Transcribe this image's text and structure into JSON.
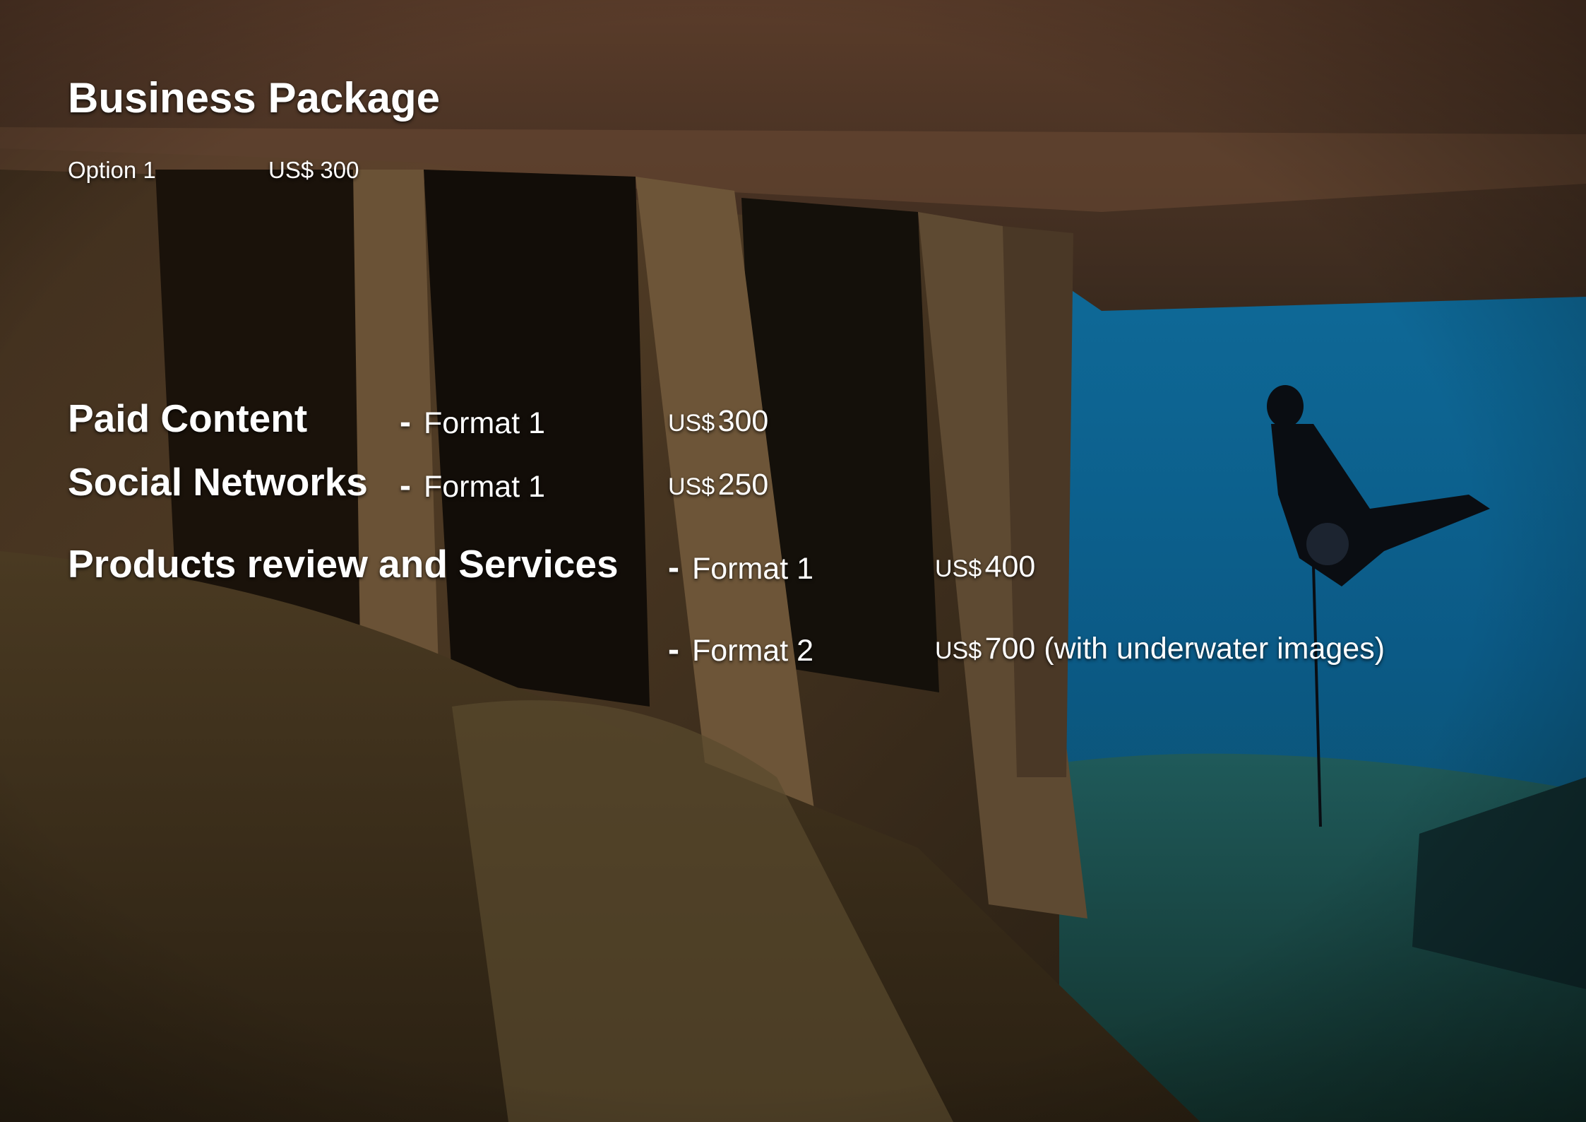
{
  "slide": {
    "title": "Business Package",
    "option": {
      "label": "Option 1",
      "price": "US$ 300"
    },
    "items": [
      {
        "heading": "Paid Content",
        "format": "Format 1",
        "currency": "US$",
        "amount": "300"
      },
      {
        "heading": "Social Networks",
        "format": "Format 1",
        "currency": "US$",
        "amount": "250"
      },
      {
        "heading": "Products review and Services",
        "format": "Format 1",
        "currency": "US$",
        "amount": "400"
      },
      {
        "heading": "",
        "format": "Format 2",
        "currency": "US$",
        "amount": "700 (with underwater images)"
      }
    ],
    "dash": "-"
  },
  "background": {
    "description_icon": "underwater-shipwreck-photo",
    "colors": {
      "wreck": "#5a4530",
      "rust": "#7a4a2a",
      "deep_water": "#0b4f7a",
      "shallow_water": "#1d7fa8",
      "sand": "#6e5a38"
    }
  }
}
